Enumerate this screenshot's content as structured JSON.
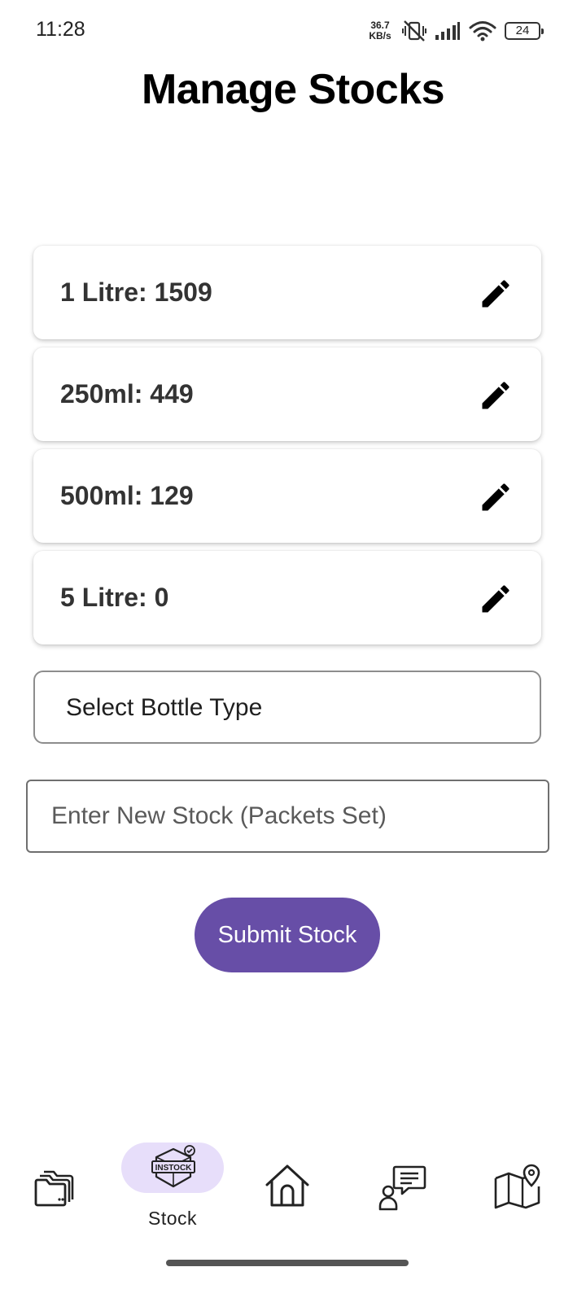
{
  "status_bar": {
    "time": "11:28",
    "net_speed_value": "36.7",
    "net_speed_unit": "KB/s",
    "battery": "24",
    "icons": [
      "vibrate-off-icon",
      "signal-icon",
      "wifi-icon",
      "battery-icon"
    ]
  },
  "page": {
    "title": "Manage Stocks"
  },
  "stocks": [
    {
      "label": "1 Litre: 1509",
      "icon": "pencil-edit-icon"
    },
    {
      "label": "250ml: 449",
      "icon": "pencil-edit-icon"
    },
    {
      "label": "500ml: 129",
      "icon": "pencil-edit-icon"
    },
    {
      "label": "5 Litre: 0",
      "icon": "pencil-edit-icon"
    }
  ],
  "form": {
    "select_placeholder": "Select Bottle Type",
    "input_placeholder": "Enter New Stock (Packets Set)",
    "input_value": "",
    "submit_label": "Submit Stock"
  },
  "nav": {
    "items": [
      {
        "name": "folders",
        "icon": "folders-icon",
        "label": ""
      },
      {
        "name": "stock",
        "icon": "instock-box-icon",
        "label": "Stock",
        "badge_text": "INSTOCK",
        "active": true
      },
      {
        "name": "home",
        "icon": "home-icon",
        "label": ""
      },
      {
        "name": "messages",
        "icon": "user-chat-icon",
        "label": ""
      },
      {
        "name": "map",
        "icon": "map-pin-icon",
        "label": ""
      }
    ]
  },
  "colors": {
    "accent": "#674ea7",
    "active_pill": "#e7defa",
    "card_text": "#333333",
    "title": "#000000"
  }
}
